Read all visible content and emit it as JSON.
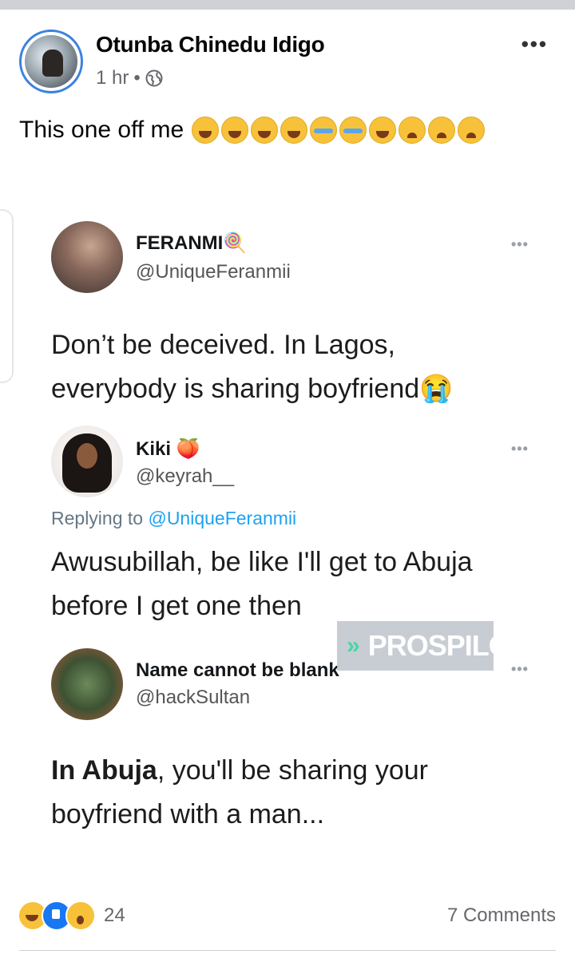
{
  "post": {
    "author": "Otunba Chinedu Idigo",
    "time": "1 hr",
    "separator": "•",
    "more_label": "•••",
    "text": "This one off me",
    "emojis": [
      "laugh",
      "laugh",
      "laugh",
      "laugh",
      "cry",
      "cry",
      "laugh",
      "weary",
      "weary",
      "weary"
    ]
  },
  "tweets": [
    {
      "name": "FERANMI🍭",
      "handle": "@UniqueFeranmii",
      "dots": "•••",
      "text_line1": "Don’t be deceived. In Lagos,",
      "text_line2": "everybody is sharing boyfriend😭"
    },
    {
      "name": "Kiki 🍑",
      "handle": "@keyrah__",
      "dots": "•••",
      "replying_prefix": "Replying to ",
      "replying_mention": "@UniqueFeranmii",
      "text_line1": "Awusubillah, be like I'll get to Abuja",
      "text_line2": "before I get  one then"
    },
    {
      "name": "Name cannot be blank",
      "handle": "@hackSultan",
      "dots": "•••",
      "text_bold": "In Abuja",
      "text_line1_rest": ", you'll be sharing your",
      "text_line2": "boyfriend with a man..."
    }
  ],
  "watermark": {
    "arrows": "»",
    "text": "PROSPILO"
  },
  "footer": {
    "reaction_count": "24",
    "comments": "7 Comments"
  },
  "colors": {
    "link": "#1da1f2",
    "meta": "#65676b",
    "like_blue": "#1877f2"
  }
}
